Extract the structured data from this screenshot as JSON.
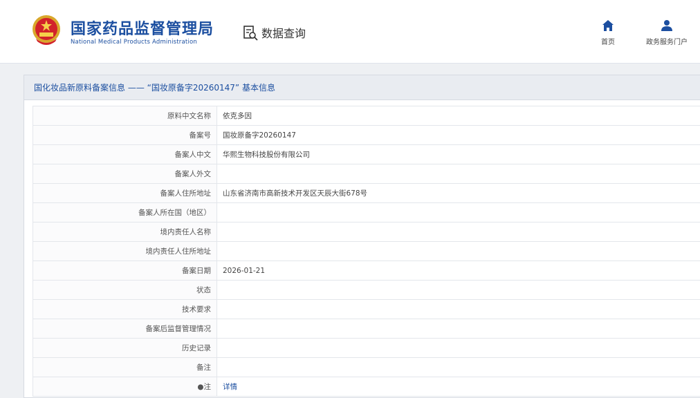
{
  "header": {
    "org_name_cn": "国家药品监督管理局",
    "org_name_en": "National Medical Products Administration",
    "emblem_icon": "national-emblem-icon",
    "query_label": "数据查询",
    "query_icon": "document-search-icon",
    "nav_home_label": "首页",
    "nav_home_icon": "home-icon",
    "nav_user_label": "政务服务门户",
    "nav_user_icon": "user-icon",
    "brand_color": "#1c4fa0"
  },
  "panel": {
    "title": "国化妆品新原料备案信息 —— “国妆原备字20260147” 基本信息",
    "rows": [
      {
        "label": "原料中文名称",
        "value": "依克多因"
      },
      {
        "label": "备案号",
        "value": "国妆原备字20260147"
      },
      {
        "label": "备案人中文",
        "value": "华熙生物科技股份有限公司"
      },
      {
        "label": "备案人外文",
        "value": ""
      },
      {
        "label": "备案人住所地址",
        "value": "山东省济南市高新技术开发区天辰大街678号"
      },
      {
        "label": "备案人所在国（地区）",
        "value": ""
      },
      {
        "label": "境内责任人名称",
        "value": ""
      },
      {
        "label": "境内责任人住所地址",
        "value": ""
      },
      {
        "label": "备案日期",
        "value": "2026-01-21"
      },
      {
        "label": "状态",
        "value": ""
      },
      {
        "label": "技术要求",
        "value": ""
      },
      {
        "label": "备案后监督管理情况",
        "value": ""
      },
      {
        "label": "历史记录",
        "value": ""
      },
      {
        "label": "备注",
        "value": ""
      },
      {
        "label": "●注",
        "value": "详情"
      }
    ]
  }
}
